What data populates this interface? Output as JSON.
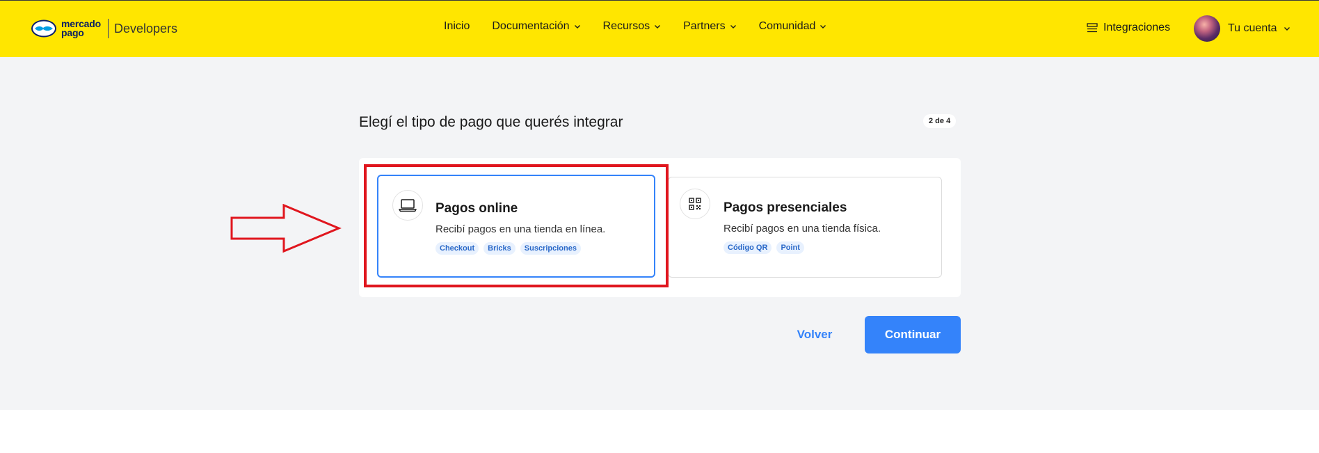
{
  "header": {
    "logo_line1": "mercado",
    "logo_line2": "pago",
    "logo_product": "Developers",
    "nav": [
      {
        "label": "Inicio",
        "has_dropdown": false
      },
      {
        "label": "Documentación",
        "has_dropdown": true
      },
      {
        "label": "Recursos",
        "has_dropdown": true
      },
      {
        "label": "Partners",
        "has_dropdown": true
      },
      {
        "label": "Comunidad",
        "has_dropdown": true
      }
    ],
    "integrations_label": "Integraciones",
    "account_label": "Tu cuenta"
  },
  "main": {
    "title": "Elegí el tipo de pago que querés integrar",
    "step": "2 de 4",
    "options": [
      {
        "title": "Pagos online",
        "description": "Recibí pagos en una tienda en línea.",
        "icon": "laptop-icon",
        "selected": true,
        "tags": [
          "Checkout",
          "Bricks",
          "Suscripciones"
        ]
      },
      {
        "title": "Pagos presenciales",
        "description": "Recibí pagos en una tienda física.",
        "icon": "qr-code-icon",
        "selected": false,
        "tags": [
          "Código QR",
          "Point"
        ]
      }
    ],
    "back_label": "Volver",
    "continue_label": "Continuar"
  },
  "colors": {
    "header_bg": "#ffe600",
    "accent": "#3483fa",
    "annotation_red": "#e0161e",
    "page_bg": "#f3f4f6"
  }
}
